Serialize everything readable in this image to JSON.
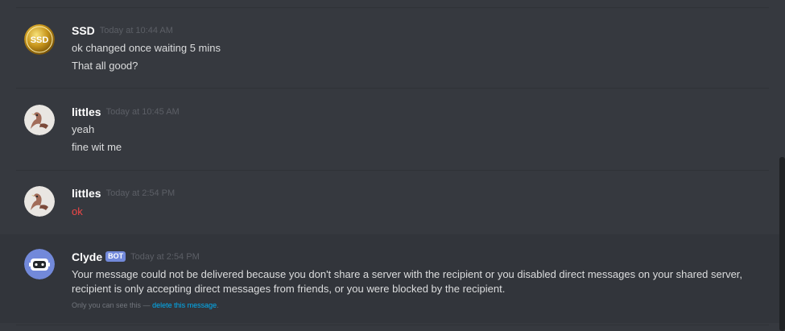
{
  "messages": [
    {
      "username": "SSD",
      "timestamp": "Today at 10:44 AM",
      "avatar_text": "SSD",
      "lines": [
        "ok changed once waiting 5 mins",
        "That all good?"
      ]
    },
    {
      "username": "littles",
      "timestamp": "Today at 10:45 AM",
      "lines": [
        "yeah",
        "fine wit me"
      ]
    },
    {
      "username": "littles",
      "timestamp": "Today at 2:54 PM",
      "lines": [
        "ok"
      ]
    },
    {
      "username": "Clyde",
      "bot_tag": "BOT",
      "timestamp": "Today at 2:54 PM",
      "text": "Your message could not be delivered because you don't share a server with the recipient or you disabled direct messages on your shared server, recipient is only accepting direct messages from friends, or you were blocked by the recipient.",
      "note_prefix": "Only you can see this —",
      "note_link": "delete this message",
      "note_suffix": "."
    }
  ],
  "colors": {
    "background": "#36393f",
    "highlight": "#32353b",
    "error_text": "#f04747",
    "link": "#00b0f4",
    "bot_tag": "#7289da"
  }
}
